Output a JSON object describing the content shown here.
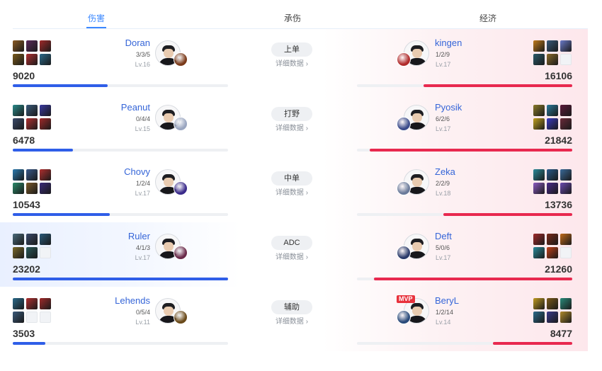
{
  "tabs": [
    {
      "label": "伤害",
      "active": true
    },
    {
      "label": "承伤",
      "active": false
    },
    {
      "label": "经济",
      "active": false
    }
  ],
  "detail_label": "详细数据",
  "detail_arrow": "›",
  "mvp_label": "MVP",
  "colors": {
    "accent_blue": "#2f5ee8",
    "accent_red": "#e8294f",
    "tab_active": "#3b88ff",
    "name_blue": "#3565d8"
  },
  "rows": [
    {
      "position": "上单",
      "left": {
        "name": "Doran",
        "kda": "3/3/5",
        "level": "Lv.16",
        "total": "9020",
        "ratio": 0.44,
        "champion_color": "#7a3a1a",
        "items": [
          "#8a5a22",
          "#5a2a5a",
          "#a02a2a",
          "#7a5a1a",
          "#b03030",
          "#2a6a8a"
        ]
      },
      "right": {
        "name": "kingen",
        "kda": "1/2/9",
        "level": "Lv.17",
        "total": "16106",
        "ratio": 0.69,
        "champion_color": "#b02a2a",
        "items": [
          "#c07a1a",
          "#3a5a7a",
          "#6a7ac8",
          "#2a5a6a",
          "#8a6a2a",
          "#e6e8ec"
        ]
      }
    },
    {
      "position": "打野",
      "left": {
        "name": "Peanut",
        "kda": "0/4/4",
        "level": "Lv.15",
        "total": "6478",
        "ratio": 0.28,
        "champion_color": "#9aa6c0",
        "items": [
          "#2a8a8a",
          "#3a5a7a",
          "#3a3aa0",
          "#3a4a6a",
          "#b03030",
          "#a02a2a"
        ]
      },
      "right": {
        "name": "Pyosik",
        "kda": "6/2/6",
        "level": "Lv.17",
        "total": "21842",
        "ratio": 0.94,
        "champion_color": "#3a4a8a",
        "items": [
          "#8a7a2a",
          "#2a7a9a",
          "#5a1a3a",
          "#c0a020",
          "#3a3ac0",
          "#6a2a3a"
        ]
      }
    },
    {
      "position": "中单",
      "left": {
        "name": "Chovy",
        "kda": "1/2/4",
        "level": "Lv.17",
        "total": "10543",
        "ratio": 0.45,
        "champion_color": "#3a2a8a",
        "items": [
          "#2a7ab0",
          "#3a5a8a",
          "#b03030",
          "#2a8a6a",
          "#7a5a2a",
          "#3a2a7a"
        ]
      },
      "right": {
        "name": "Zeka",
        "kda": "2/2/9",
        "level": "Lv.18",
        "total": "13736",
        "ratio": 0.6,
        "champion_color": "#6a7a9a",
        "items": [
          "#2a8a9a",
          "#2a5a8a",
          "#3a6a9a",
          "#8a5ac0",
          "#4a2a8a",
          "#6a4ab0"
        ]
      }
    },
    {
      "position": "ADC",
      "left": {
        "name": "Ruler",
        "kda": "4/1/3",
        "level": "Lv.17",
        "total": "23202",
        "ratio": 1.0,
        "highlight": true,
        "champion_color": "#6a2a4a",
        "items": [
          "#4a6a7a",
          "#3a4a6a",
          "#2a5a7a",
          "#7a6a2a",
          "#2a5a5a",
          "#e6e8ec"
        ]
      },
      "right": {
        "name": "Deft",
        "kda": "5/0/6",
        "level": "Lv.17",
        "total": "21260",
        "ratio": 0.92,
        "champion_color": "#2a3a6a",
        "items": [
          "#a02a2a",
          "#7a2a1a",
          "#c06a1a",
          "#2a8a9a",
          "#c0401a",
          "#e6e8ec"
        ]
      }
    },
    {
      "position": "辅助",
      "left": {
        "name": "Lehends",
        "kda": "0/5/4",
        "level": "Lv.11",
        "total": "3503",
        "ratio": 0.15,
        "champion_color": "#6a4a1a",
        "items": [
          "#2a6a8a",
          "#b03030",
          "#a02a2a",
          "#3a5a7a",
          "#e6e8ec",
          "#e6e8ec"
        ]
      },
      "right": {
        "name": "BeryL",
        "kda": "1/2/14",
        "level": "Lv.14",
        "total": "8477",
        "ratio": 0.37,
        "mvp": true,
        "champion_color": "#2a4a7a",
        "items": [
          "#c09a20",
          "#7a5a1a",
          "#2a8a7a",
          "#2a6a8a",
          "#3a3a8a",
          "#b08a2a"
        ]
      }
    }
  ]
}
